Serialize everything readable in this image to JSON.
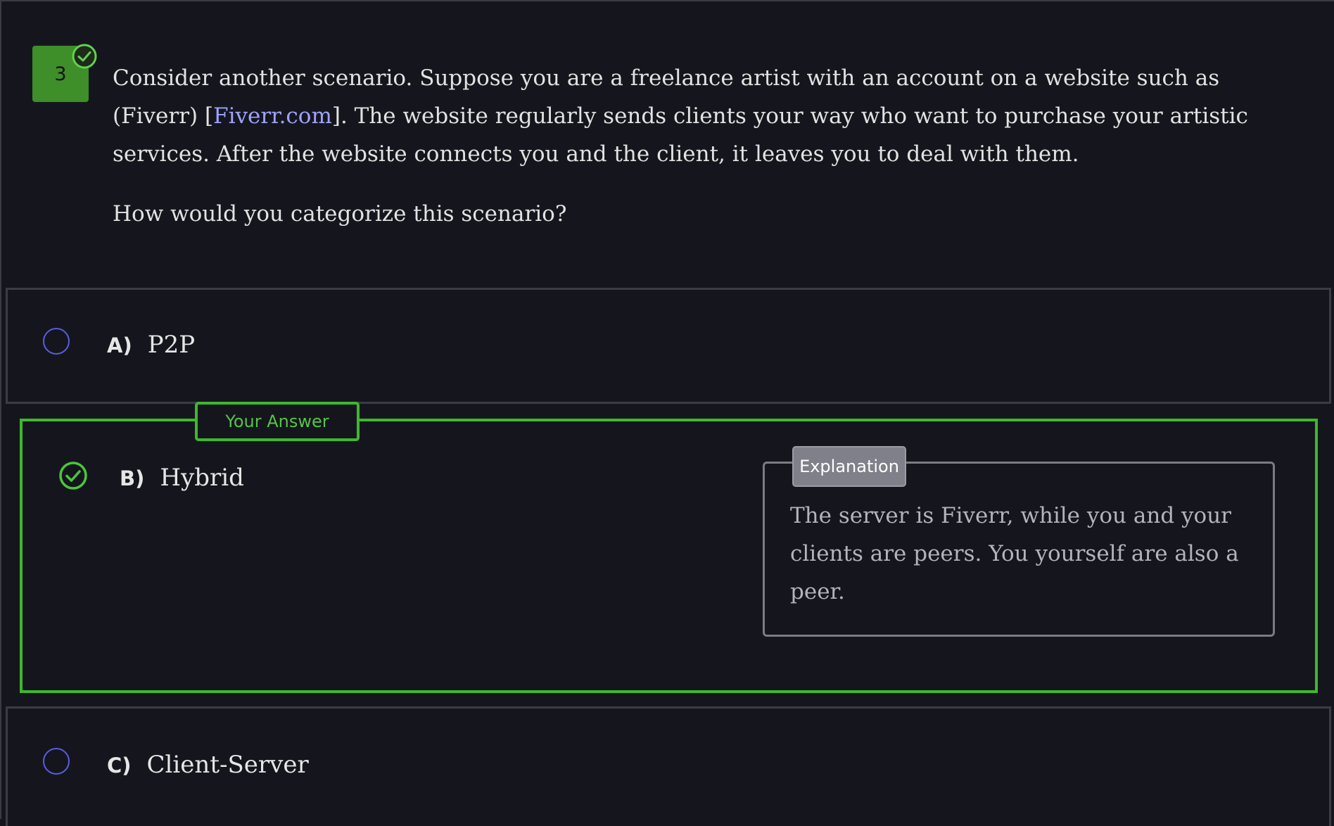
{
  "question": {
    "number": "3",
    "text_before_link": "Consider another scenario. Suppose you are a freelance artist with an account on a website such as (Fiverr) [",
    "link_text": "Fiverr.com",
    "text_after_link": "]. The website regularly sends clients your way who want to purchase your artistic services. After the website connects you and the client, it leaves you to deal with them.",
    "prompt": "How would you categorize this scenario?"
  },
  "options": [
    {
      "letter": "A)",
      "label": "P2P",
      "selected": false
    },
    {
      "letter": "B)",
      "label": "Hybrid",
      "selected": true
    },
    {
      "letter": "C)",
      "label": "Client-Server",
      "selected": false
    }
  ],
  "your_answer_label": "Your Answer",
  "explanation": {
    "tag": "Explanation",
    "text": "The server is Fiverr, while you and your clients are peers. You yourself are also a peer."
  },
  "colors": {
    "correct_accent": "#3db82e",
    "radio_accent": "#5b5be6",
    "link": "#a0a2ff",
    "background": "#15161d"
  }
}
